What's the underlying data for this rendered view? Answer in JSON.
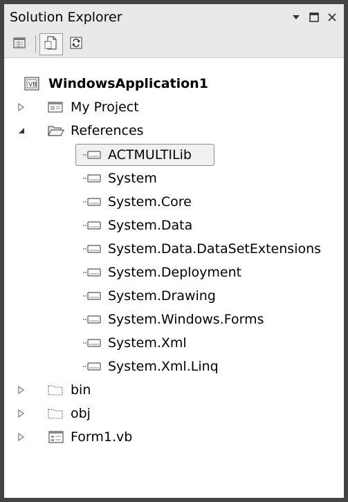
{
  "window": {
    "title": "Solution Explorer",
    "controls": {
      "dropdown": "dropdown-arrow-icon",
      "maximize": "maximize-icon",
      "close": "close-icon"
    }
  },
  "toolbar": {
    "buttons": [
      {
        "icon": "properties-icon"
      },
      {
        "icon": "show-all-files-icon"
      },
      {
        "icon": "refresh-icon"
      }
    ]
  },
  "tree": {
    "project": "WindowsApplication1",
    "my_project": "My Project",
    "references": "References",
    "reference_items": [
      "ACTMULTILib",
      "System",
      "System.Core",
      "System.Data",
      "System.Data.DataSetExtensions",
      "System.Deployment",
      "System.Drawing",
      "System.Windows.Forms",
      "System.Xml",
      "System.Xml.Linq"
    ],
    "bin": "bin",
    "obj": "obj",
    "form": "Form1.vb"
  },
  "colors": {
    "border": "#444444",
    "titlebar": "#e9e9e9",
    "selection_bg": "#f0f0f0",
    "selection_border": "#8c8c8c"
  }
}
